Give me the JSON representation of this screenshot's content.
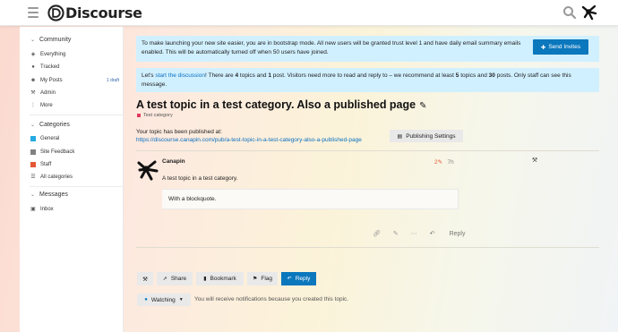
{
  "header": {
    "logo_text": "Discourse",
    "icons": {
      "menu": "hamburger-icon",
      "search": "search-icon",
      "avatar": "user-avatar"
    }
  },
  "sidebar": {
    "community": {
      "heading": "Community",
      "items": [
        {
          "label": "Everything",
          "icon": "layers-icon"
        },
        {
          "label": "Tracked",
          "icon": "bell-icon"
        },
        {
          "label": "My Posts",
          "icon": "user-icon",
          "badge": "1 draft"
        },
        {
          "label": "Admin",
          "icon": "wrench-icon"
        },
        {
          "label": "More",
          "icon": "ellipsis-icon"
        }
      ]
    },
    "categories": {
      "heading": "Categories",
      "items": [
        {
          "label": "General",
          "color": "#25aae1"
        },
        {
          "label": "Site Feedback",
          "color": "#808281"
        },
        {
          "label": "Staff",
          "color": "#e45735"
        },
        {
          "label": "All categories",
          "icon": "list-icon"
        }
      ]
    },
    "messages": {
      "heading": "Messages",
      "items": [
        {
          "label": "Inbox",
          "icon": "inbox-icon"
        }
      ]
    }
  },
  "banners": {
    "bootstrap": "To make launching your new site easier, you are in bootstrap mode. All new users will be granted trust level 1 and have daily email summary emails enabled. This will be automatically turned off when 50 users have joined.",
    "send_invites": "Send Invites",
    "discussion": {
      "pre": "Let's ",
      "link": "start the discussion",
      "post1": "! There are ",
      "topics": "4",
      "post2": " topics and ",
      "posts": "1",
      "post3": " post. Visitors need more to read and reply to – we recommend at least ",
      "rec_topics": "5",
      "post4": " topics and ",
      "rec_posts": "30",
      "post5": " posts. Only staff can see this message."
    }
  },
  "topic": {
    "title": "A test topic in a test category. Also a published page",
    "category": "Test category",
    "category_color": "#e03a5c",
    "published_label": "Your topic has been published at:",
    "published_url": "https://discourse.canapin.com/pub/a-test-topic-in-a-test-category-also-a-published-page",
    "publishing_settings": "Publishing Settings"
  },
  "post": {
    "author": "Canapin",
    "edits": "2",
    "age": "7h",
    "body": "A test topic in a test category.",
    "quote": "With a blockquote.",
    "reply": "Reply"
  },
  "footer": {
    "share": "Share",
    "bookmark": "Bookmark",
    "flag": "Flag",
    "reply": "Reply",
    "watching": "Watching",
    "watching_note": "You will receive notifications because you created this topic."
  },
  "colors": {
    "accent": "#0b77bd",
    "banner_bg": "#d1f0ff",
    "link": "#0a6fc0",
    "edit": "#e45735"
  }
}
